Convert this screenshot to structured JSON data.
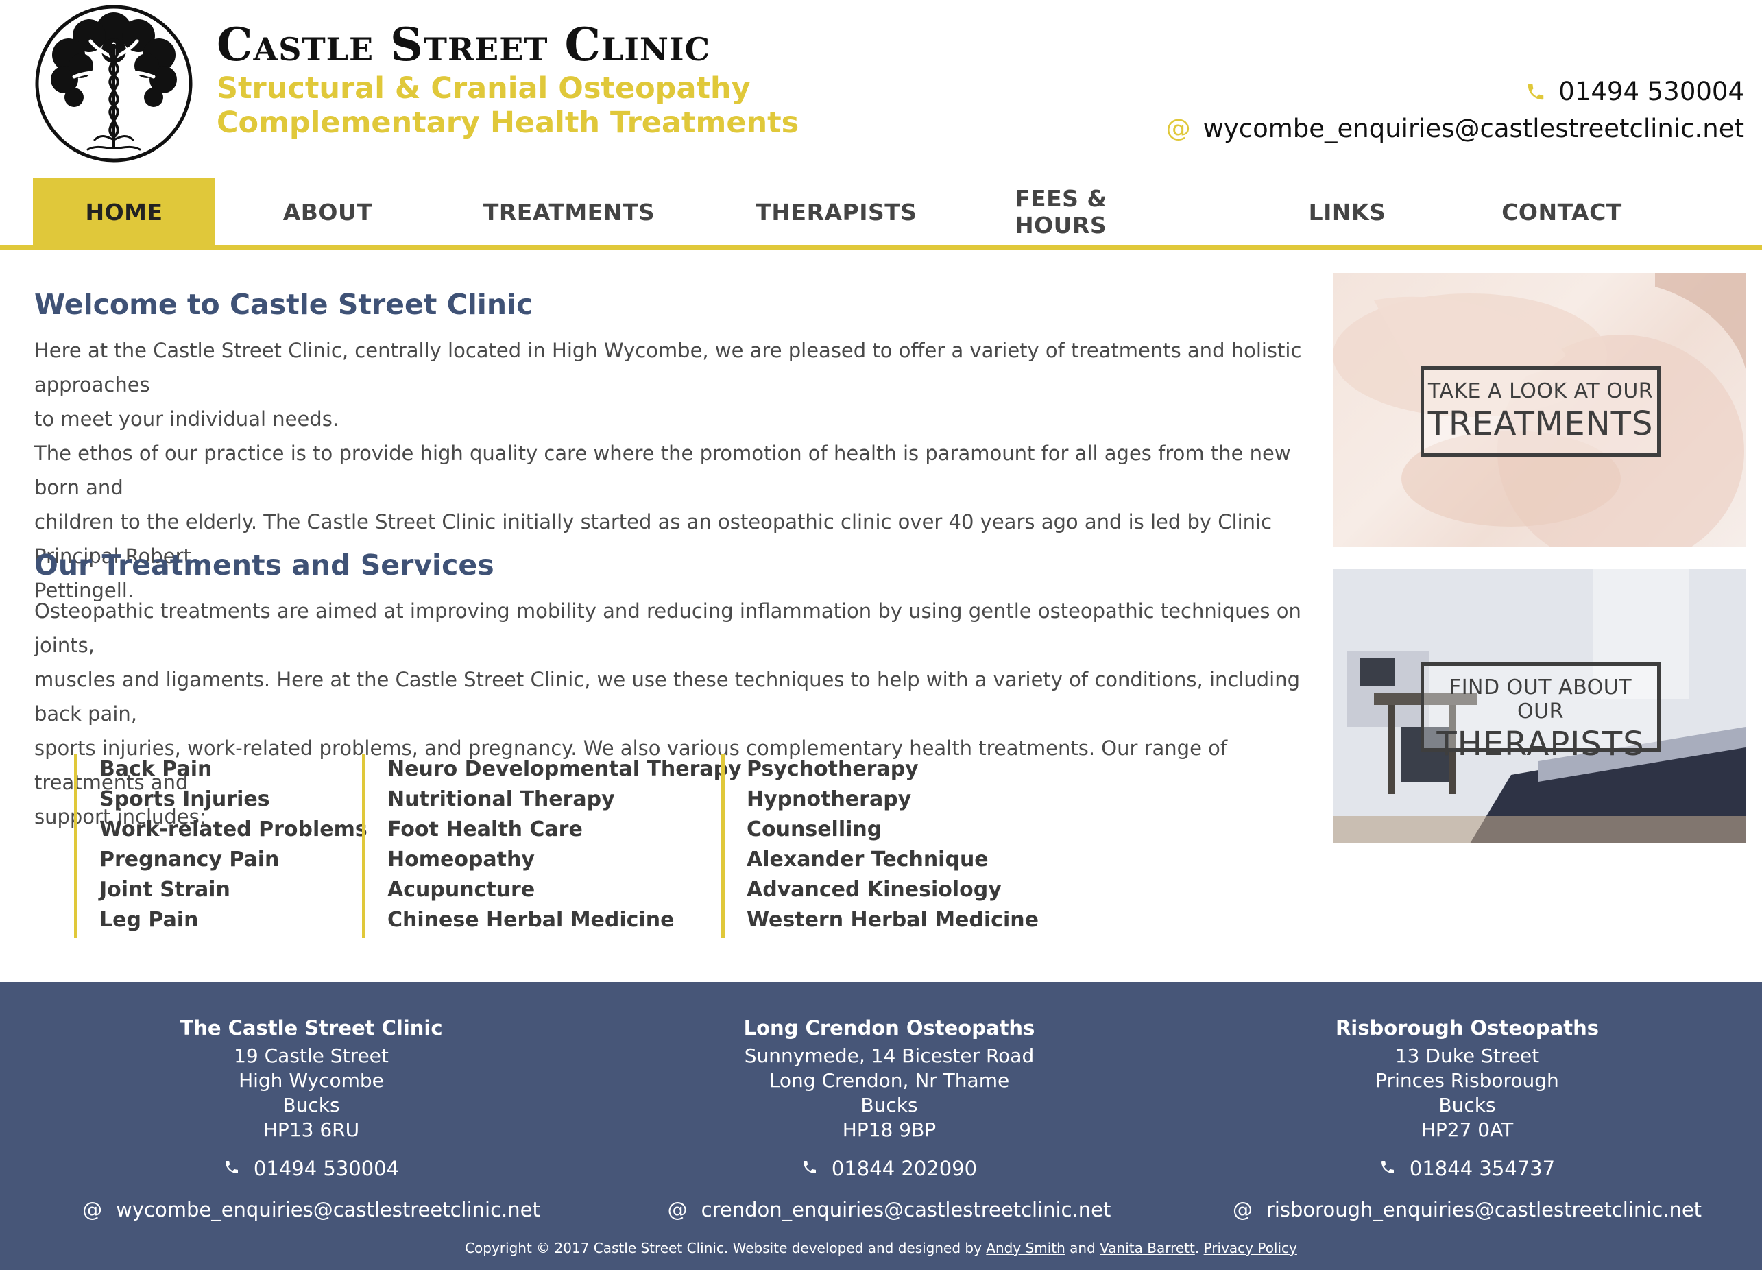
{
  "header": {
    "title": "Castle Street Clinic",
    "subtitle_1": "Structural & Cranial Osteopathy",
    "subtitle_2": "Complementary Health Treatments",
    "phone": "01494 530004",
    "email": "wycombe_enquiries@castlestreetclinic.net",
    "phone_icon": "phone-icon",
    "email_icon": "at-icon"
  },
  "nav": {
    "items": [
      {
        "label": "HOME",
        "active": true
      },
      {
        "label": "ABOUT"
      },
      {
        "label": "TREATMENTS"
      },
      {
        "label": "THERAPISTS"
      },
      {
        "label": "FEES & HOURS"
      },
      {
        "label": "LINKS"
      },
      {
        "label": "CONTACT"
      }
    ]
  },
  "welcome": {
    "heading": "Welcome to Castle Street Clinic",
    "p1_line1": "Here at the Castle Street Clinic, centrally located in High Wycombe, we are pleased to offer a variety of treatments and holistic approaches",
    "p1_line2": "to meet your individual needs.",
    "p2_line1": "The ethos of our practice is to provide high quality care where the promotion of health is paramount for all ages from the new born and",
    "p2_line2": "children to the elderly. The Castle Street Clinic initially started as an osteopathic clinic over 40 years ago and is led by Clinic Principal Robert",
    "p2_line3": "Pettingell."
  },
  "services": {
    "heading": "Our Treatments and Services",
    "line1": "Osteopathic treatments are aimed at improving mobility and reducing inflammation by using gentle osteopathic techniques on joints,",
    "line2": "muscles and ligaments. Here at the Castle Street Clinic, we use these techniques to help with a variety of conditions, including back pain,",
    "line3": "sports injuries, work-related problems, and pregnancy. We also various complementary health treatments. Our range of treatments and",
    "line4": "support includes:",
    "col1": [
      "Back Pain",
      "Sports Injuries",
      "Work-related Problems",
      "Pregnancy Pain",
      "Joint Strain",
      "Leg Pain"
    ],
    "col2": [
      "Neuro Developmental Therapy",
      "Nutritional Therapy",
      "Foot Health Care",
      "Homeopathy",
      "Acupuncture",
      "Chinese Herbal Medicine"
    ],
    "col3": [
      "Psychotherapy",
      "Hypnotherapy",
      "Counselling",
      "Alexander Technique",
      "Advanced Kinesiology",
      "Western Herbal Medicine"
    ]
  },
  "promos": {
    "treatments": {
      "small": "TAKE A LOOK AT OUR",
      "big": "TREATMENTS"
    },
    "therapists": {
      "small": "FIND OUT ABOUT OUR",
      "big": "THERAPISTS"
    }
  },
  "footer": {
    "clinics": [
      {
        "name": "The Castle Street Clinic",
        "addr": [
          "19 Castle Street",
          "High Wycombe",
          "Bucks",
          "HP13 6RU"
        ],
        "phone": "01494 530004",
        "email": "wycombe_enquiries@castlestreetclinic.net"
      },
      {
        "name": "Long Crendon Osteopaths",
        "addr": [
          "Sunnymede, 14 Bicester Road",
          "Long Crendon, Nr Thame",
          "Bucks",
          "HP18 9BP"
        ],
        "phone": "01844 202090",
        "email": "crendon_enquiries@castlestreetclinic.net"
      },
      {
        "name": "Risborough Osteopaths",
        "addr": [
          "13 Duke Street",
          "Princes Risborough",
          "Bucks",
          "HP27 0AT"
        ],
        "phone": "01844 354737",
        "email": "risborough_enquiries@castlestreetclinic.net"
      }
    ],
    "copyright_prefix": "Copyright © 2017 Castle Street Clinic. Website developed and designed by",
    "author1": "Andy Smith",
    "and": "and",
    "author2": "Vanita Barrett",
    "period": ".",
    "privacy": "Privacy Policy",
    "accent_color": "#e0c83a",
    "footer_bg": "#475678"
  }
}
